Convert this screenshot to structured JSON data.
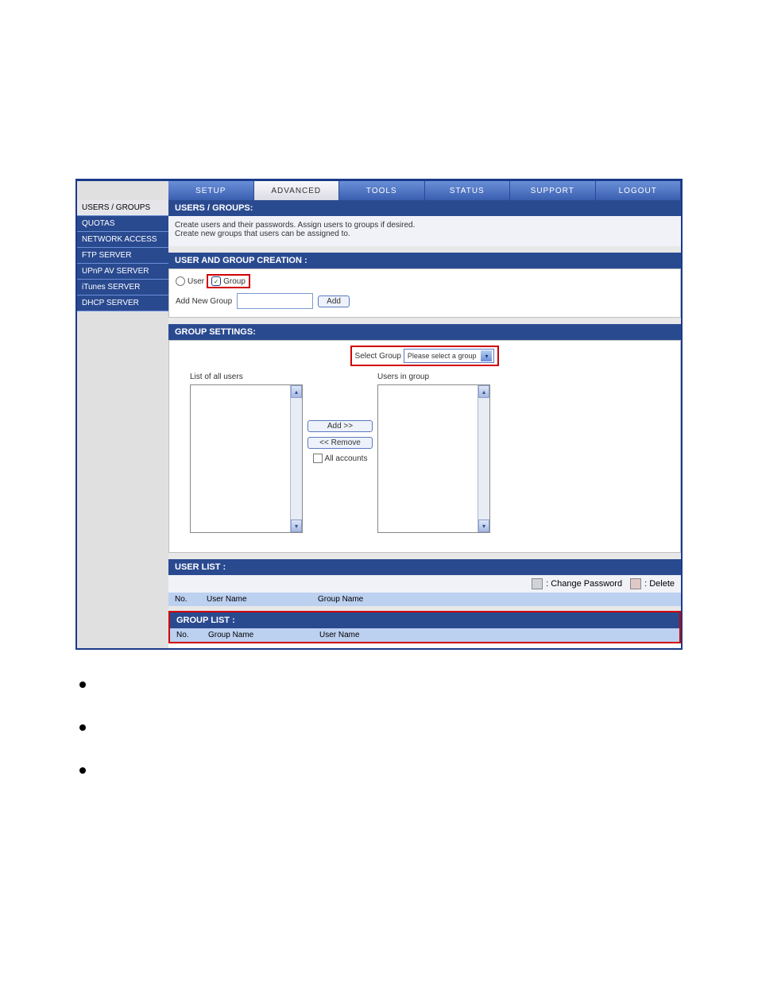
{
  "topnav": {
    "tabs": [
      "SETUP",
      "ADVANCED",
      "TOOLS",
      "STATUS",
      "SUPPORT",
      "LOGOUT"
    ]
  },
  "sidebar": {
    "items": [
      {
        "label": "USERS / GROUPS"
      },
      {
        "label": "QUOTAS"
      },
      {
        "label": "NETWORK ACCESS"
      },
      {
        "label": "FTP SERVER"
      },
      {
        "label": "UPnP AV SERVER"
      },
      {
        "label": "iTunes SERVER"
      },
      {
        "label": "DHCP SERVER"
      }
    ]
  },
  "panels": {
    "users_groups": {
      "title": "USERS / GROUPS:",
      "desc1": "Create users and their passwords. Assign users to groups if desired.",
      "desc2": "Create new groups that users can be assigned to."
    },
    "creation": {
      "title": "USER AND GROUP CREATION :",
      "radio_user": "User",
      "radio_group": "Group",
      "add_new_label": "Add New Group",
      "add_btn": "Add"
    },
    "group_settings": {
      "title": "GROUP SETTINGS:",
      "select_label": "Select Group",
      "select_value": "Please select a group",
      "list_all": "List of all users",
      "users_in_group": "Users in group",
      "add_btn": "Add >>",
      "remove_btn": "<< Remove",
      "all_accounts": "All accounts"
    },
    "user_list": {
      "title": "USER LIST :",
      "legend_change": ": Change Password",
      "legend_delete": ": Delete",
      "col_no": "No.",
      "col_user": "User Name",
      "col_group": "Group Name"
    },
    "group_list": {
      "title": "GROUP LIST :",
      "col_no": "No.",
      "col_group": "Group Name",
      "col_user": "User Name"
    }
  }
}
